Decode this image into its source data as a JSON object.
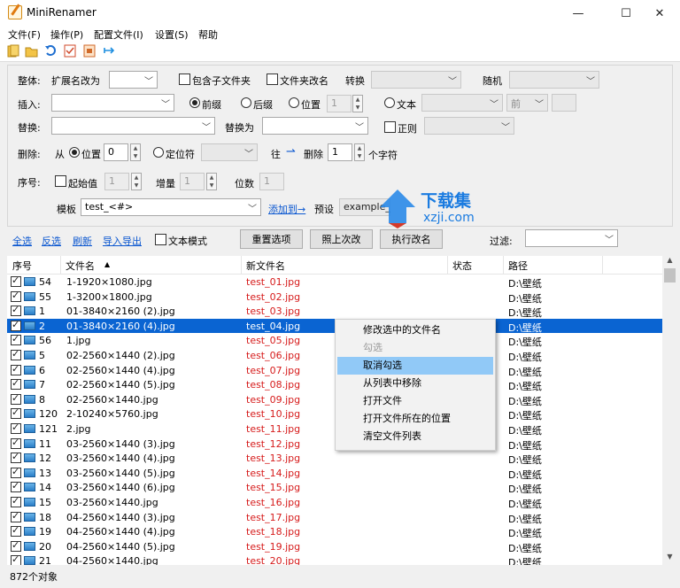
{
  "window": {
    "title": "MiniRenamer",
    "minimize": "—",
    "maximize": "☐",
    "close": "✕"
  },
  "menu": [
    "文件(F)",
    "操作(P)",
    "配置文件(I)",
    "设置(S)",
    "帮助"
  ],
  "options": {
    "whole_label": "整体:",
    "ext_label": "扩展名改为",
    "ext_value": "",
    "include_subfolders": "包含子文件夹",
    "rename_folder": "文件夹改名",
    "convert_label": "转换",
    "random_label": "随机",
    "insert_label": "插入:",
    "prefix": "前缀",
    "suffix": "后缀",
    "position": "位置",
    "position_value": "1",
    "text": "文本",
    "front": "前",
    "replace_label": "替换:",
    "replace_with": "替换为",
    "regex": "正则",
    "delete_label": "删除:",
    "from": "从",
    "del_position": "位置",
    "del_position_value": "0",
    "locator": "定位符",
    "toward": "往",
    "arrow": "⇀",
    "delete": "删除",
    "delete_count": "1",
    "chars": "个字符",
    "seq_label": "序号:",
    "start_value": "起始值",
    "start_value_num": "1",
    "increment": "增量",
    "increment_num": "1",
    "digits": "位数",
    "digits_num": "1",
    "template_label": "模板",
    "template_value": "test_<#>",
    "add_to": "添加到→",
    "preset": "预设",
    "preset_value": "example_"
  },
  "actions": {
    "select_all": "全选",
    "invert": "反选",
    "refresh": "刷新",
    "import_export": "导入导出",
    "text_mode": "文本模式",
    "reset": "重置选项",
    "last_time": "照上次改",
    "rename": "执行改名",
    "filter": "过滤:"
  },
  "columns": {
    "seq": "序号",
    "filename": "文件名",
    "sort": "▲",
    "newname": "新文件名",
    "status": "状态",
    "path": "路径"
  },
  "rows": [
    {
      "seq": "54",
      "file": "1-1920×1080.jpg",
      "new": "test_01.jpg",
      "path": "D:\\壁纸"
    },
    {
      "seq": "55",
      "file": "1-3200×1800.jpg",
      "new": "test_02.jpg",
      "path": "D:\\壁纸"
    },
    {
      "seq": "1",
      "file": "01-3840×2160 (2).jpg",
      "new": "test_03.jpg",
      "path": "D:\\壁纸"
    },
    {
      "seq": "2",
      "file": "01-3840×2160 (4).jpg",
      "new": "test_04.jpg",
      "path": "D:\\壁纸"
    },
    {
      "seq": "56",
      "file": "1.jpg",
      "new": "test_05.jpg",
      "path": "D:\\壁纸"
    },
    {
      "seq": "5",
      "file": "02-2560×1440 (2).jpg",
      "new": "test_06.jpg",
      "path": "D:\\壁纸"
    },
    {
      "seq": "6",
      "file": "02-2560×1440 (4).jpg",
      "new": "test_07.jpg",
      "path": "D:\\壁纸"
    },
    {
      "seq": "7",
      "file": "02-2560×1440 (5).jpg",
      "new": "test_08.jpg",
      "path": "D:\\壁纸"
    },
    {
      "seq": "8",
      "file": "02-2560×1440.jpg",
      "new": "test_09.jpg",
      "path": "D:\\壁纸"
    },
    {
      "seq": "120",
      "file": "2-10240×5760.jpg",
      "new": "test_10.jpg",
      "path": "D:\\壁纸"
    },
    {
      "seq": "121",
      "file": "2.jpg",
      "new": "test_11.jpg",
      "path": "D:\\壁纸"
    },
    {
      "seq": "11",
      "file": "03-2560×1440 (3).jpg",
      "new": "test_12.jpg",
      "path": "D:\\壁纸"
    },
    {
      "seq": "12",
      "file": "03-2560×1440 (4).jpg",
      "new": "test_13.jpg",
      "path": "D:\\壁纸"
    },
    {
      "seq": "13",
      "file": "03-2560×1440 (5).jpg",
      "new": "test_14.jpg",
      "path": "D:\\壁纸"
    },
    {
      "seq": "14",
      "file": "03-2560×1440 (6).jpg",
      "new": "test_15.jpg",
      "path": "D:\\壁纸"
    },
    {
      "seq": "15",
      "file": "03-2560×1440.jpg",
      "new": "test_16.jpg",
      "path": "D:\\壁纸"
    },
    {
      "seq": "18",
      "file": "04-2560×1440 (3).jpg",
      "new": "test_17.jpg",
      "path": "D:\\壁纸"
    },
    {
      "seq": "19",
      "file": "04-2560×1440 (4).jpg",
      "new": "test_18.jpg",
      "path": "D:\\壁纸"
    },
    {
      "seq": "20",
      "file": "04-2560×1440 (5).jpg",
      "new": "test_19.jpg",
      "path": "D:\\壁纸"
    },
    {
      "seq": "21",
      "file": "04-2560×1440.jpg",
      "new": "test_20.jpg",
      "path": "D:\\壁纸"
    }
  ],
  "context_menu": [
    "修改选中的文件名",
    "勾选",
    "取消勾选",
    "从列表中移除",
    "打开文件",
    "打开文件所在的位置",
    "清空文件列表"
  ],
  "watermark": {
    "title": "下载集",
    "domain": "xzji.com"
  },
  "status": "872个对象",
  "colors": {
    "selection": "#0a64d2",
    "newname": "#d61b1b",
    "menu_hover": "#91c9f7",
    "link": "#0b57d0"
  }
}
